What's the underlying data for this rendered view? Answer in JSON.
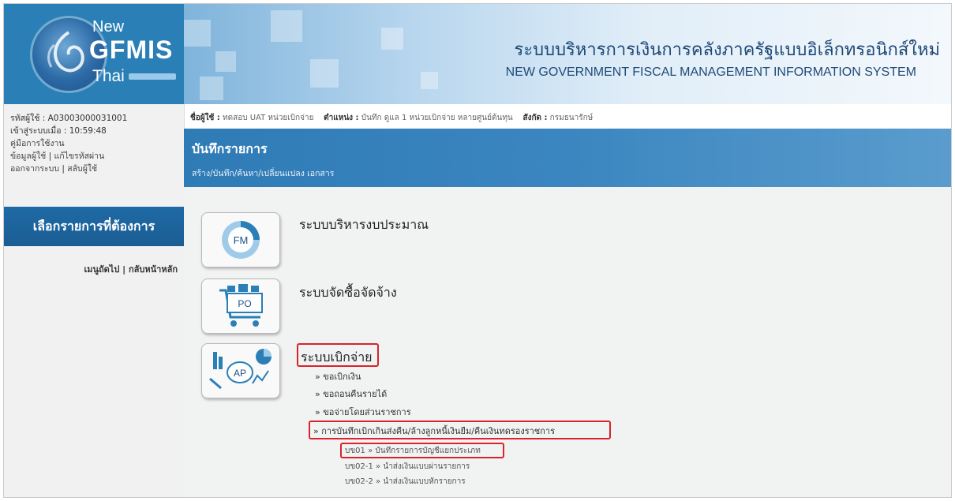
{
  "logo": {
    "line1": "New",
    "line2": "GFMIS",
    "line3": "Thai"
  },
  "header": {
    "title_th": "ระบบบริหารการเงินการคลังภาครัฐแบบอิเล็กทรอนิกส์ใหม่",
    "title_en": "NEW GOVERNMENT FISCAL MANAGEMENT INFORMATION SYSTEM"
  },
  "sidebar": {
    "user_code": "รหัสผู้ใช้ : A03003000031001",
    "login_time": "เข้าสู่ระบบเมื่อ : 10:59:48",
    "manual": "คู่มือการใช้งาน",
    "profile": "ข้อมูลผู้ใช้",
    "change_password": "แก้ไขรหัสผ่าน",
    "logout": "ออกจากระบบ",
    "switch_user": "สลับผู้ใช้",
    "menu_button": "เลือกรายการที่ต้องการ",
    "next_menu": "เมนูถัดไป",
    "home": "กลับหน้าหลัก"
  },
  "userbar": {
    "name_label": "ชื่อผู้ใช้ :",
    "name_value": "ทดสอบ UAT หน่วยเบิกจ่าย",
    "position_label": "ตำแหน่ง :",
    "position_value": "บันทึก ดูแล 1 หน่วยเบิกจ่าย หลายศูนย์ต้นทุน",
    "dept_label": "สังกัด :",
    "dept_value": "กรมธนารักษ์"
  },
  "page": {
    "title": "บันทึกรายการ",
    "subtitle": "สร้าง/บันทึก/ค้นหา/เปลี่ยนแปลง เอกสาร"
  },
  "systems": {
    "fm": {
      "icon_label": "FM",
      "title": "ระบบบริหารงบประมาณ"
    },
    "po": {
      "icon_label": "PO",
      "title": "ระบบจัดซื้อจัดจ้าง"
    },
    "ap": {
      "icon_label": "AP",
      "title": "ระบบเบิกจ่าย",
      "links": [
        "» ขอเบิกเงิน",
        "» ขอถอนคืนรายได้",
        "» ขอจ่ายโดยส่วนราชการ",
        "» การบันทึกเบิกเกินส่งคืน/ล้างลูกหนี้เงินยืม/คืนเงินทดรองราชการ"
      ],
      "sub_links": [
        "บข01 » บันทึกรายการบัญชีแยกประเภท",
        "บข02-1 » นำส่งเงินแบบผ่านรายการ",
        "บข02-2 » นำส่งเงินแบบหักรายการ"
      ]
    }
  },
  "colors": {
    "accent": "#2f7bb6",
    "highlight": "#d9232d"
  }
}
